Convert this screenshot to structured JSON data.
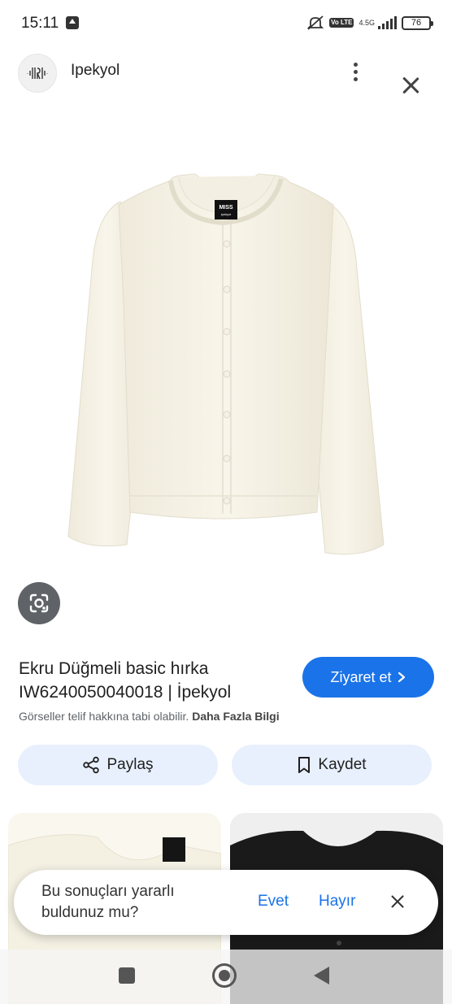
{
  "status_bar": {
    "time": "15:11",
    "network": "4.5G",
    "volte": "Vo LTE",
    "battery": "76"
  },
  "header": {
    "site_name": "Ipekyol",
    "icons": [
      "site-logo",
      "more-vert-icon",
      "close-icon"
    ]
  },
  "product": {
    "title": "Ekru Düğmeli basic hırka IW6240050040018 | İpekyol",
    "label_brand": "MISS",
    "label_sub": "ipekyol",
    "color": "#f7f3e6"
  },
  "actions": {
    "visit_label": "Ziyaret et",
    "copyright_text": "Görseller telif hakkına tabi olabilir.",
    "more_info_label": "Daha Fazla Bilgi",
    "share_label": "Paylaş",
    "save_label": "Kaydet"
  },
  "feedback": {
    "question": "Bu sonuçları yararlı buldunuz mu?",
    "yes_label": "Evet",
    "no_label": "Hayır"
  },
  "colors": {
    "accent": "#1a73e8",
    "tonal_button": "#e8f0fe",
    "lens_button": "#5f6368"
  }
}
